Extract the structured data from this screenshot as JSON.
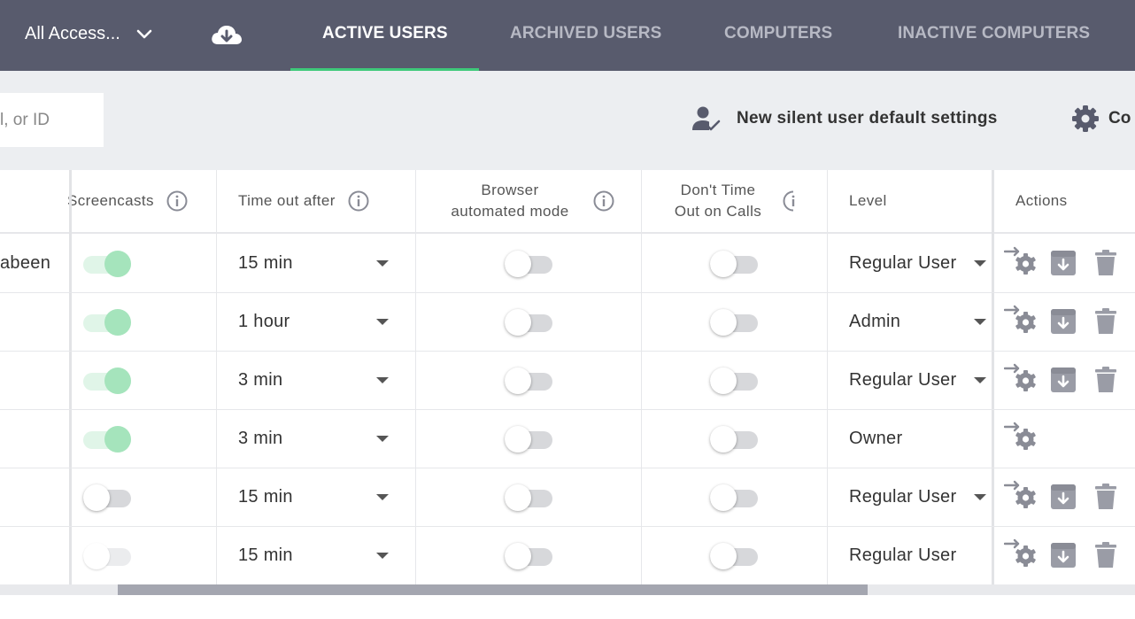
{
  "header": {
    "org_selector": "All Access...",
    "tabs": [
      "ACTIVE USERS",
      "ARCHIVED USERS",
      "COMPUTERS",
      "INACTIVE COMPUTERS"
    ],
    "active_tab": "ACTIVE USERS",
    "accent_color": "#3ec97a",
    "background_color": "#585b6d"
  },
  "toolbar": {
    "search_placeholder": "l, or ID",
    "silent_settings_label": "New silent user default settings",
    "config_label": "Co"
  },
  "table": {
    "columns": {
      "screencasts": "Screencasts",
      "time_out_after": "Time out after",
      "browser_line1": "Browser",
      "browser_line2": "automated mode",
      "dont_line1": "Don't Time",
      "dont_line2": "Out on Calls",
      "level": "Level",
      "actions": "Actions"
    },
    "rows": [
      {
        "name": "abeen",
        "screencasts": true,
        "timeout": "15 min",
        "browser": false,
        "dont_timeout": false,
        "level": "Regular User",
        "level_dropdown": true,
        "archive": true,
        "delete": true
      },
      {
        "name": "",
        "screencasts": true,
        "timeout": "1 hour",
        "browser": false,
        "dont_timeout": false,
        "level": "Admin",
        "level_dropdown": true,
        "archive": true,
        "delete": true
      },
      {
        "name": "",
        "screencasts": true,
        "timeout": "3 min",
        "browser": false,
        "dont_timeout": false,
        "level": "Regular User",
        "level_dropdown": true,
        "archive": true,
        "delete": true
      },
      {
        "name": "",
        "screencasts": true,
        "timeout": "3 min",
        "browser": false,
        "dont_timeout": false,
        "level": "Owner",
        "level_dropdown": false,
        "archive": false,
        "delete": false
      },
      {
        "name": "",
        "screencasts": false,
        "timeout": "15 min",
        "browser": false,
        "dont_timeout": false,
        "level": "Regular User",
        "level_dropdown": true,
        "archive": true,
        "delete": true
      },
      {
        "name": "",
        "screencasts": false,
        "timeout": "15 min",
        "browser": false,
        "dont_timeout": false,
        "level": "Regular User",
        "level_dropdown": false,
        "archive": true,
        "delete": true
      }
    ]
  }
}
